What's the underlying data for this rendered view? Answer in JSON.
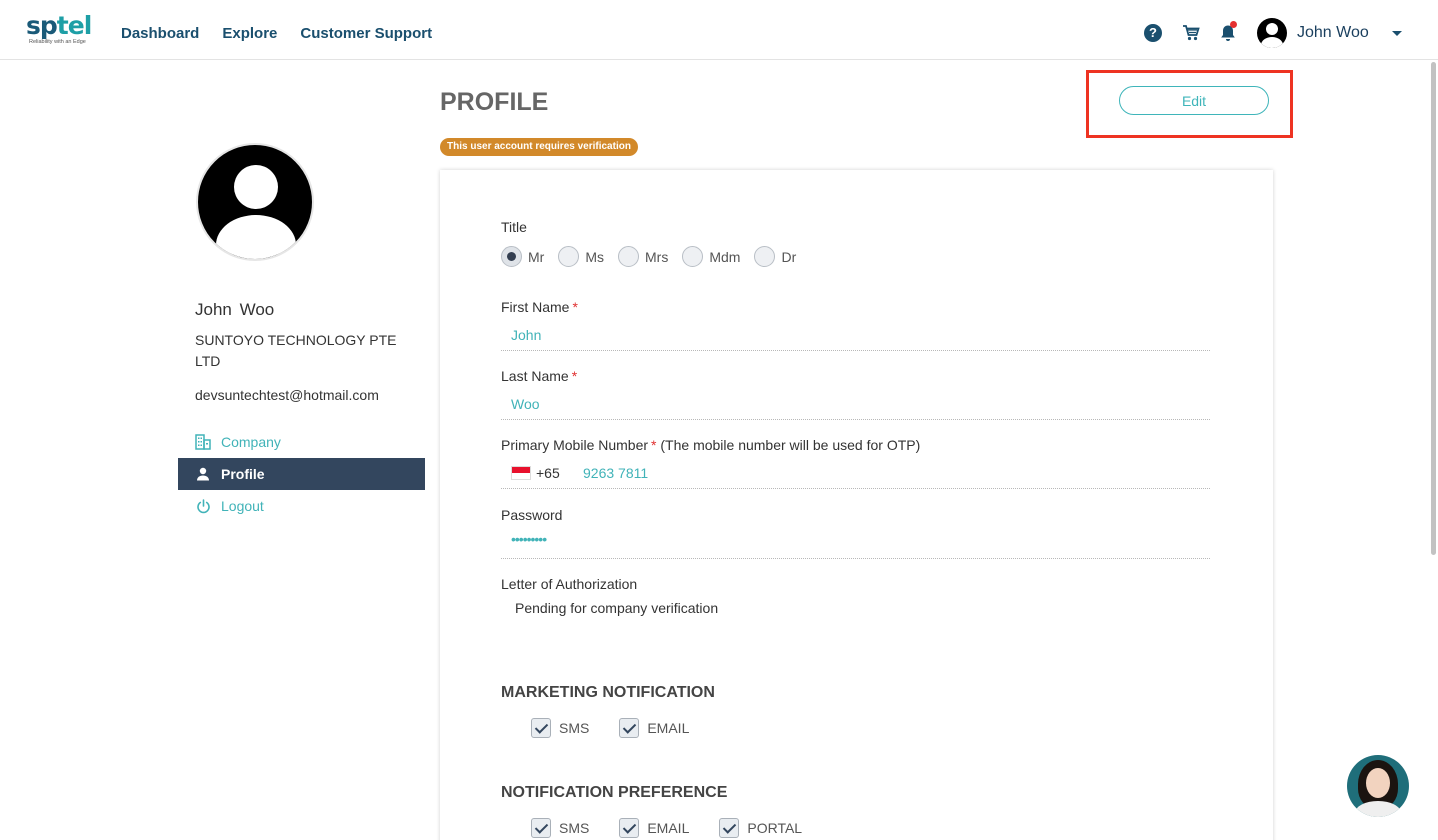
{
  "header": {
    "logo_text_a": "sp",
    "logo_text_b": "tel",
    "logo_tagline": "Reliability with an Edge",
    "nav": [
      "Dashboard",
      "Explore",
      "Customer Support"
    ],
    "help_glyph": "?",
    "user_name": "John Woo",
    "icons": [
      "help-icon",
      "cart-icon",
      "bell-icon",
      "avatar",
      "chevron-down-icon"
    ],
    "notification_dot_color": "#e53030"
  },
  "sidebar": {
    "name": "John Woo",
    "company": "SUNTOYO TECHNOLOGY PTE LTD",
    "email": "devsuntechtest@hotmail.com",
    "menu": [
      {
        "label": "Company",
        "icon": "building-icon",
        "active": false
      },
      {
        "label": "Profile",
        "icon": "person-icon",
        "active": true
      },
      {
        "label": "Logout",
        "icon": "power-icon",
        "active": false
      }
    ]
  },
  "main": {
    "title": "PROFILE",
    "verification_badge": "This user account requires verification",
    "edit_label": "Edit",
    "form": {
      "title_label": "Title",
      "title_options": [
        "Mr",
        "Ms",
        "Mrs",
        "Mdm",
        "Dr"
      ],
      "title_selected": "Mr",
      "first_name_label": "First Name",
      "first_name_value": "John",
      "last_name_label": "Last Name",
      "last_name_value": "Woo",
      "mobile_label": "Primary Mobile Number",
      "mobile_note": "(The mobile number will be used for OTP)",
      "dial_code": "+65",
      "mobile_value": "9263 7811",
      "password_label": "Password",
      "password_value": "•••••••••",
      "loa_label": "Letter of Authorization",
      "loa_value": "Pending for company verification",
      "required_mark": "*"
    },
    "marketing": {
      "title": "MARKETING NOTIFICATION",
      "options": [
        {
          "label": "SMS",
          "checked": true
        },
        {
          "label": "EMAIL",
          "checked": true
        }
      ]
    },
    "preference": {
      "title": "NOTIFICATION PREFERENCE",
      "options": [
        {
          "label": "SMS",
          "checked": true
        },
        {
          "label": "EMAIL",
          "checked": true
        },
        {
          "label": "PORTAL",
          "checked": true
        }
      ]
    }
  },
  "colors": {
    "accent": "#41b3b8",
    "nav": "#1a4f6e",
    "sidebar_active": "#33465e",
    "badge": "#d2892a",
    "highlight": "#ee3322"
  }
}
